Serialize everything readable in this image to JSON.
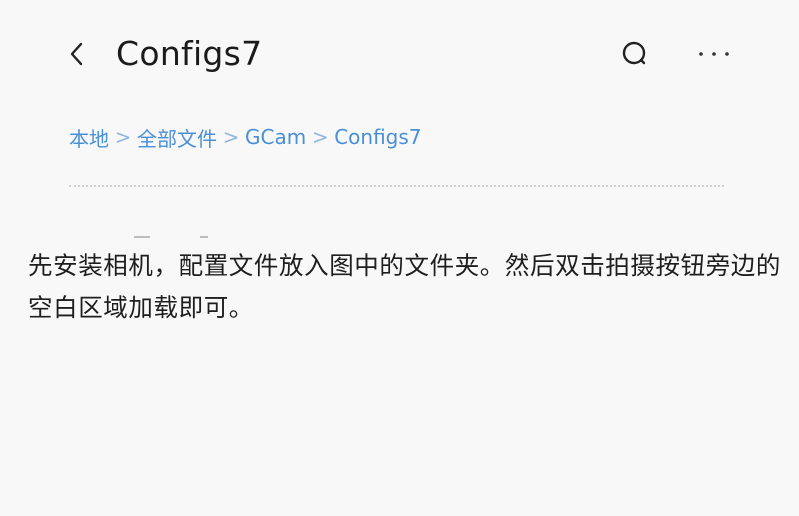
{
  "header": {
    "title": "Configs7",
    "back_icon": "chevron-left-icon",
    "search_icon": "search-icon",
    "more_icon": "more-horizontal-icon"
  },
  "breadcrumb": {
    "items": [
      "本地",
      "全部文件",
      "GCam",
      "Configs7"
    ],
    "separator": ">"
  },
  "instructions": {
    "text": "先安装相机，配置文件放入图中的文件夹。然后双击拍摄按钮旁边的空白区域加载即可。"
  },
  "colors": {
    "background": "#f8f8f8",
    "title_text": "#1b1b1b",
    "breadcrumb_link": "#4a8fd6",
    "body_text": "#1e1e1e"
  }
}
